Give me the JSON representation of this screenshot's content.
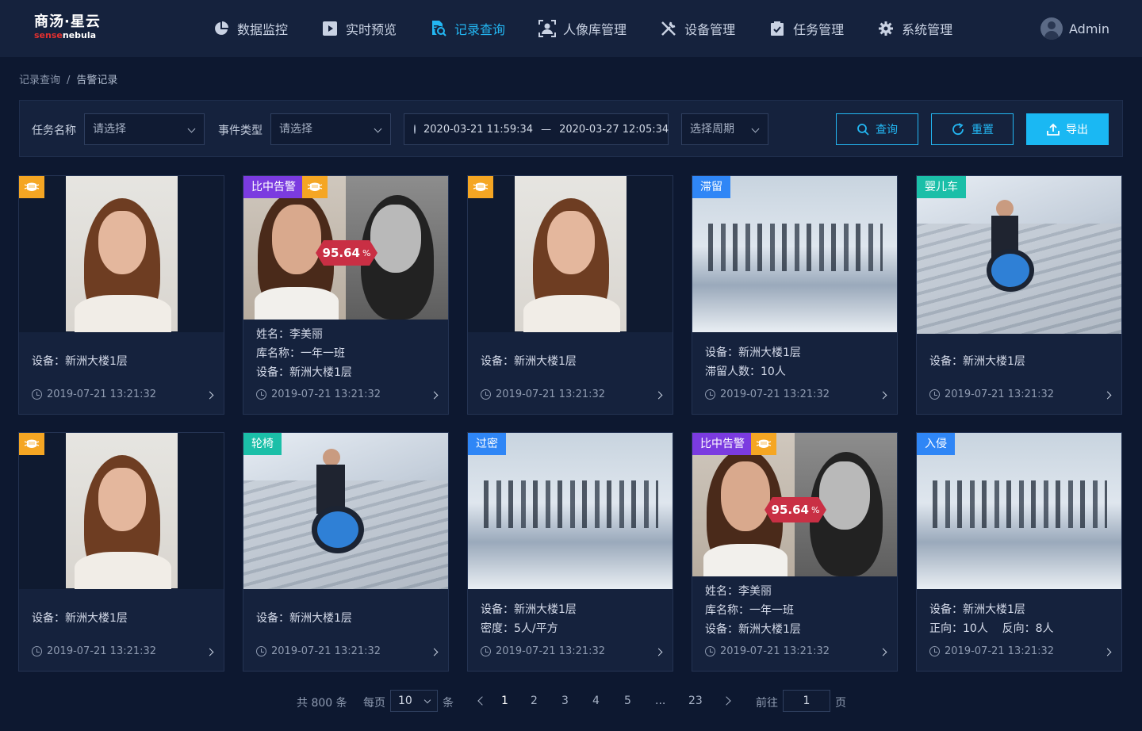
{
  "app": {
    "logo_cn": "商汤·星云",
    "logo_en_red": "sense",
    "logo_en_white": "nebula"
  },
  "nav": {
    "items": [
      {
        "label": "数据监控"
      },
      {
        "label": "实时预览"
      },
      {
        "label": "记录查询"
      },
      {
        "label": "人像库管理"
      },
      {
        "label": "设备管理"
      },
      {
        "label": "任务管理"
      },
      {
        "label": "系统管理"
      }
    ],
    "active_label": "记录查询",
    "active_color": "#23b7f3"
  },
  "user": {
    "name": "Admin"
  },
  "breadcrumb": {
    "root": "记录查询",
    "sep": "/",
    "current": "告警记录"
  },
  "filter": {
    "task_label": "任务名称",
    "task_placeholder": "请选择",
    "event_label": "事件类型",
    "event_placeholder": "请选择",
    "date_start": "2020-03-21 11:59:34",
    "date_sep": "—",
    "date_end": "2020-03-27 12:05:34",
    "period_placeholder": "选择周期",
    "query_label": "查询",
    "reset_label": "重置",
    "export_label": "导出"
  },
  "cards": [
    {
      "lines": [
        "设备：新洲大楼1层"
      ],
      "time": "2019-07-21  13:21:32"
    },
    {
      "tag": "比中告警",
      "score": "95.64",
      "score_unit": "%",
      "lines": [
        "姓名：李美丽",
        "库名称：一年一班",
        "设备：新洲大楼1层"
      ],
      "time": "2019-07-21  13:21:32"
    },
    {
      "lines": [
        "设备：新洲大楼1层"
      ],
      "time": "2019-07-21  13:21:32"
    },
    {
      "tag": "滞留",
      "lines": [
        "设备：新洲大楼1层",
        "滞留人数：10人"
      ],
      "time": "2019-07-21  13:21:32"
    },
    {
      "tag": "婴儿车",
      "lines": [
        "设备：新洲大楼1层"
      ],
      "time": "2019-07-21  13:21:32"
    },
    {
      "lines": [
        "设备：新洲大楼1层"
      ],
      "time": "2019-07-21  13:21:32"
    },
    {
      "tag": "轮椅",
      "lines": [
        "设备：新洲大楼1层"
      ],
      "time": "2019-07-21  13:21:32"
    },
    {
      "tag": "过密",
      "lines": [
        "设备：新洲大楼1层",
        "密度：5人/平方"
      ],
      "time": "2019-07-21  13:21:32"
    },
    {
      "tag": "比中告警",
      "score": "95.64",
      "score_unit": "%",
      "lines": [
        "姓名：李美丽",
        "库名称：一年一班",
        "设备：新洲大楼1层"
      ],
      "time": "2019-07-21  13:21:32"
    },
    {
      "tag": "入侵",
      "lines": [
        "设备：新洲大楼1层",
        "正向：10人    反向：8人"
      ],
      "time": "2019-07-21  13:21:32"
    }
  ],
  "pagination": {
    "total": "共 800 条",
    "per_page_label": "每页",
    "per_page_value": "10",
    "per_page_unit": "条",
    "pages": [
      "1",
      "2",
      "3",
      "4",
      "5",
      "...",
      "23"
    ],
    "current_page": "1",
    "jump_label": "前往",
    "jump_value": "1",
    "jump_unit": "页"
  },
  "colors": {
    "accent": "#23b7f3",
    "mask_badge": "#f5a623",
    "tag_purple": "#7b3be0",
    "tag_blue": "#2f86f6",
    "tag_teal": "#1bbfa8",
    "score_red": "#c92f44"
  }
}
